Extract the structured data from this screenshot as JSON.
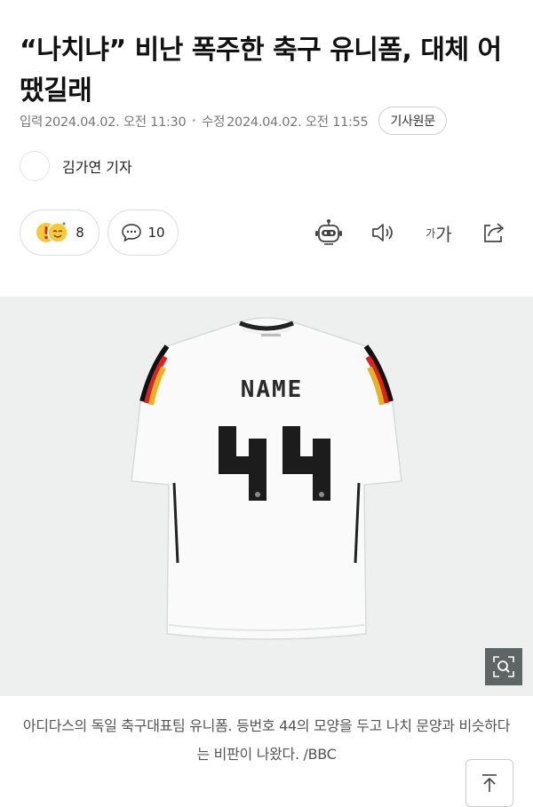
{
  "article": {
    "headline": "“나치냐” 비난 폭주한 축구 유니폼, 대체 어땠길래",
    "published_label": "입력",
    "published_time": "2024.04.02. 오전 11:30",
    "modified_label": "수정",
    "modified_time": "2024.04.02. 오전 11:55",
    "original_button": "기사원문",
    "reporter": "김가연 기자"
  },
  "actions": {
    "reaction_count": "8",
    "comment_count": "10",
    "font_size_label_small": "가",
    "font_size_label_large": "가"
  },
  "photo": {
    "jersey_name": "NAME",
    "jersey_number": "44",
    "caption": "아디다스의 독일 축구대표팀 유니폼. 등번호 44의 모양을 두고 나치 문양과 비슷하다는 비판이 나왔다. /BBC"
  },
  "colors": {
    "accent": "#111111",
    "meta": "#777777",
    "photo_bg": "#eef0f0"
  },
  "icons": [
    "robot-icon",
    "speaker-icon",
    "font-size-icon",
    "share-icon",
    "zoom-icon",
    "arrow-up-icon",
    "comment-icon",
    "reaction-emoji-icon"
  ]
}
